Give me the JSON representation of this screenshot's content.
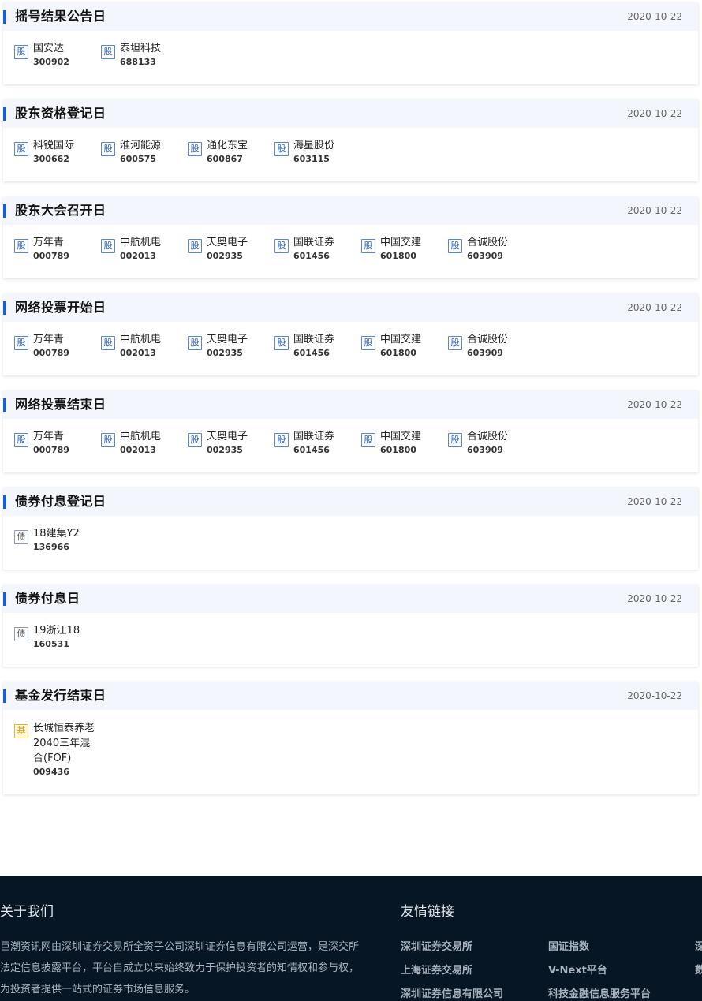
{
  "sections": [
    {
      "title": "摇号结果公告日",
      "date": "2020-10-22",
      "items": [
        {
          "type": "股",
          "name": "国安达",
          "code": "300902"
        },
        {
          "type": "股",
          "name": "泰坦科技",
          "code": "688133"
        }
      ]
    },
    {
      "title": "股东资格登记日",
      "date": "2020-10-22",
      "items": [
        {
          "type": "股",
          "name": "科锐国际",
          "code": "300662"
        },
        {
          "type": "股",
          "name": "淮河能源",
          "code": "600575"
        },
        {
          "type": "股",
          "name": "通化东宝",
          "code": "600867"
        },
        {
          "type": "股",
          "name": "海星股份",
          "code": "603115"
        }
      ]
    },
    {
      "title": "股东大会召开日",
      "date": "2020-10-22",
      "items": [
        {
          "type": "股",
          "name": "万年青",
          "code": "000789"
        },
        {
          "type": "股",
          "name": "中航机电",
          "code": "002013"
        },
        {
          "type": "股",
          "name": "天奥电子",
          "code": "002935"
        },
        {
          "type": "股",
          "name": "国联证券",
          "code": "601456"
        },
        {
          "type": "股",
          "name": "中国交建",
          "code": "601800"
        },
        {
          "type": "股",
          "name": "合诚股份",
          "code": "603909"
        }
      ]
    },
    {
      "title": "网络投票开始日",
      "date": "2020-10-22",
      "items": [
        {
          "type": "股",
          "name": "万年青",
          "code": "000789"
        },
        {
          "type": "股",
          "name": "中航机电",
          "code": "002013"
        },
        {
          "type": "股",
          "name": "天奥电子",
          "code": "002935"
        },
        {
          "type": "股",
          "name": "国联证券",
          "code": "601456"
        },
        {
          "type": "股",
          "name": "中国交建",
          "code": "601800"
        },
        {
          "type": "股",
          "name": "合诚股份",
          "code": "603909"
        }
      ]
    },
    {
      "title": "网络投票结束日",
      "date": "2020-10-22",
      "items": [
        {
          "type": "股",
          "name": "万年青",
          "code": "000789"
        },
        {
          "type": "股",
          "name": "中航机电",
          "code": "002013"
        },
        {
          "type": "股",
          "name": "天奥电子",
          "code": "002935"
        },
        {
          "type": "股",
          "name": "国联证券",
          "code": "601456"
        },
        {
          "type": "股",
          "name": "中国交建",
          "code": "601800"
        },
        {
          "type": "股",
          "name": "合诚股份",
          "code": "603909"
        }
      ]
    },
    {
      "title": "债券付息登记日",
      "date": "2020-10-22",
      "items": [
        {
          "type": "债",
          "name": "18建集Y2",
          "code": "136966"
        }
      ]
    },
    {
      "title": "债券付息日",
      "date": "2020-10-22",
      "items": [
        {
          "type": "债",
          "name": "19浙江18",
          "code": "160531"
        }
      ]
    },
    {
      "title": "基金发行结束日",
      "date": "2020-10-22",
      "items": [
        {
          "type": "基",
          "name": "长城恒泰养老2040三年混合(FOF)",
          "code": "009436"
        }
      ]
    }
  ],
  "footer": {
    "about_title": "关于我们",
    "about_text": "巨潮资讯网由深圳证券交易所全资子公司深圳证券信息有限公司运营，是深交所法定信息披露平台，平台自成立以来始终致力于保护投资者的知情权和参与权，为投资者提供一站式的证券市场信息服务。",
    "links_title": "友情链接",
    "links": [
      "深圳证券交易所",
      "国证指数",
      "深",
      "上海证券交易所",
      "V-Next平台",
      "数",
      "深圳证券信息有限公司",
      "科技金融信息服务平台"
    ]
  },
  "colors": {
    "accent": "#1d5fd0",
    "header_bg": "#f3f6fc",
    "footer_bg": "#061624",
    "fund_badge": "#e6b43b"
  }
}
